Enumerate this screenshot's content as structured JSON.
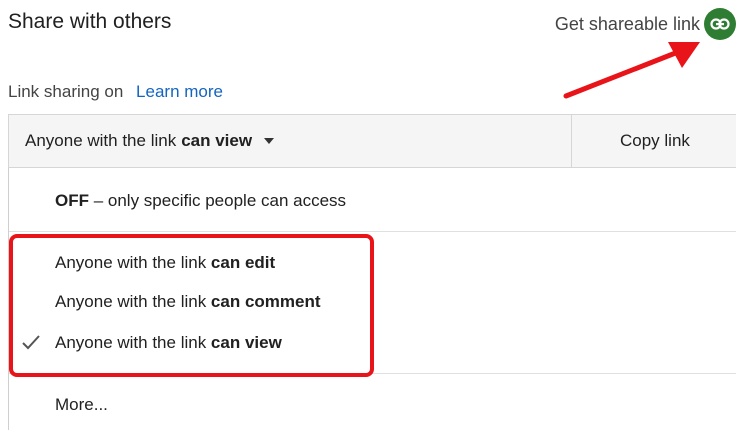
{
  "header": {
    "title": "Share with others",
    "get_link_label": "Get shareable link"
  },
  "sharing": {
    "status": "Link sharing on",
    "learn_more": "Learn more"
  },
  "dropdown": {
    "selected_prefix": "Anyone with the link",
    "selected_bold": "can view",
    "copy_label": "Copy link"
  },
  "menu": {
    "off_bold": "OFF",
    "off_rest": " – only specific people can access",
    "items": [
      {
        "prefix": "Anyone with the link ",
        "bold": "can edit"
      },
      {
        "prefix": "Anyone with the link ",
        "bold": "can comment"
      },
      {
        "prefix": "Anyone with the link ",
        "bold": "can view"
      }
    ],
    "more": "More..."
  },
  "colors": {
    "link_icon_bg": "#2e7d32",
    "annotation_red": "#e8141a",
    "learn_more": "#1565c0"
  }
}
